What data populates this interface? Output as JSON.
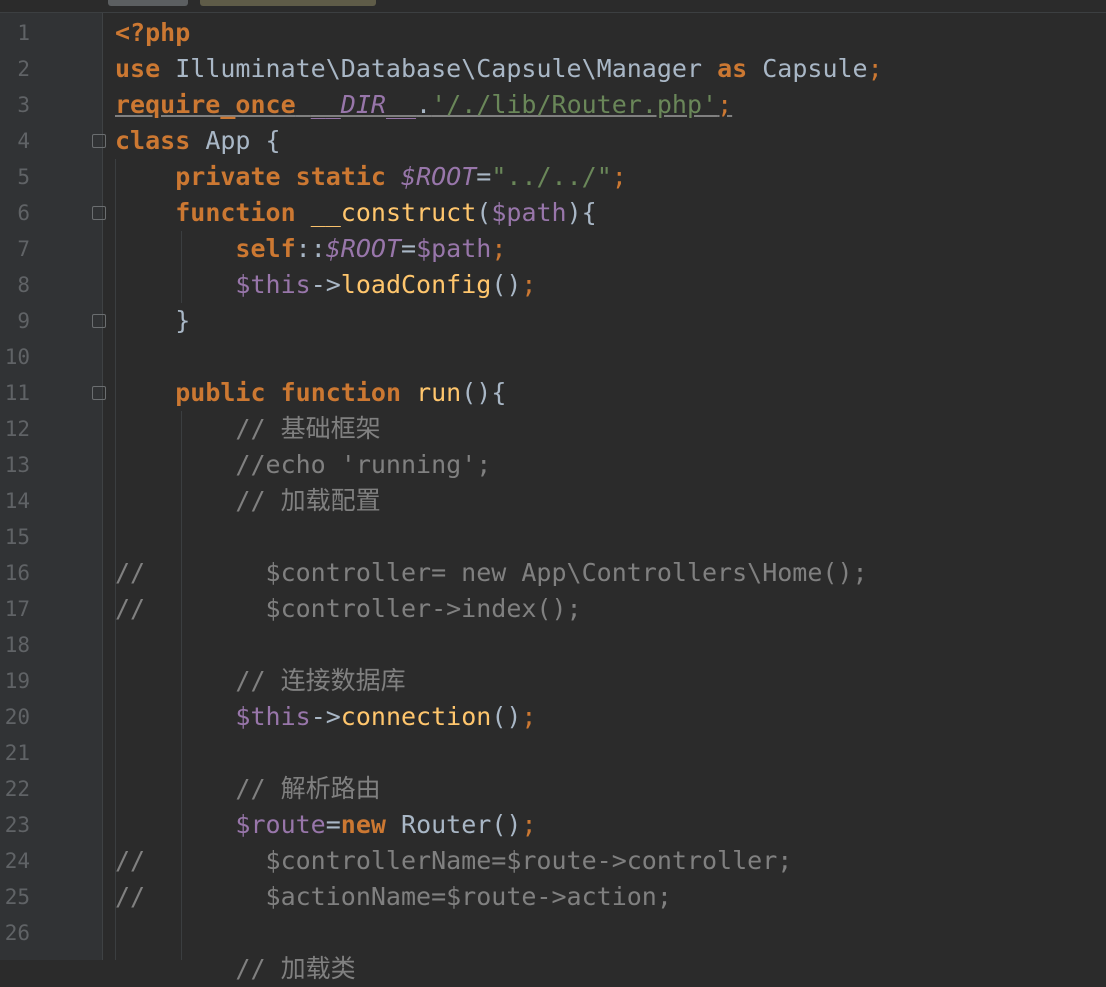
{
  "editor": {
    "line_numbers": [
      "1",
      "2",
      "3",
      "4",
      "5",
      "6",
      "7",
      "8",
      "9",
      "10",
      "11",
      "12",
      "13",
      "14",
      "15",
      "16",
      "17",
      "18",
      "19",
      "20",
      "21",
      "22",
      "23",
      "24",
      "25",
      "26"
    ],
    "code": {
      "l1": "<?php",
      "l2_kw": "use",
      "l2_path": "Illuminate\\Database\\Capsule\\Manager",
      "l2_as": "as",
      "l2_name": "Capsule",
      "l3_kw": "require_once",
      "l3_dir": "__DIR__",
      "l3_str": "'/./lib/Router.php'",
      "l4_kw": "class",
      "l4_name": "App",
      "l5_kw1": "private",
      "l5_kw2": "static",
      "l5_var": "$ROOT",
      "l5_str": "\"../../\"",
      "l6_kw": "function",
      "l6_fn": "__construct",
      "l6_var": "$path",
      "l7_self": "self",
      "l7_var": "$ROOT",
      "l7_val": "$path",
      "l8_this": "$this",
      "l8_fn": "loadConfig",
      "l11_kw1": "public",
      "l11_kw2": "function",
      "l11_fn": "run",
      "l12": "// 基础框架",
      "l13": "//echo 'running';",
      "l14": "// 加载配置",
      "l16": "//        $controller= new App\\Controllers\\Home();",
      "l17": "//        $controller->index();",
      "l19": "// 连接数据库",
      "l20_this": "$this",
      "l20_fn": "connection",
      "l22": "// 解析路由",
      "l23_var": "$route",
      "l23_kw": "new",
      "l23_cls": "Router",
      "l24": "//        $controllerName=$route->controller;",
      "l25": "//        $actionName=$route->action;",
      "l27": "// 加载类"
    }
  }
}
